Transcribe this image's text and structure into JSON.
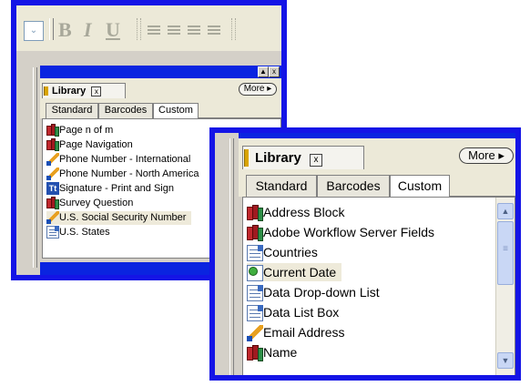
{
  "back": {
    "toolbar": {
      "dropdown_arrow": "⌄",
      "bold": "B",
      "italic": "I",
      "underline": "U"
    },
    "panel": {
      "title": "Library",
      "close": "x",
      "more": "More ▸",
      "minimize": "▲",
      "winclose": "x",
      "tabs": [
        "Standard",
        "Barcodes",
        "Custom"
      ],
      "items": [
        {
          "label": "Page n of m",
          "icon": "book-icon"
        },
        {
          "label": "Page Navigation",
          "icon": "book-icon"
        },
        {
          "label": "Phone Number - International",
          "icon": "pen-icon"
        },
        {
          "label": "Phone Number - North America",
          "icon": "pen-icon"
        },
        {
          "label": "Signature - Print and Sign",
          "icon": "signature-icon"
        },
        {
          "label": "Survey Question",
          "icon": "book-icon"
        },
        {
          "label": "U.S. Social Security Number",
          "icon": "pen-icon"
        },
        {
          "label": "U.S. States",
          "icon": "list-icon"
        }
      ]
    }
  },
  "front": {
    "panel": {
      "title": "Library",
      "close": "x",
      "more": "More ▸",
      "tabs": [
        "Standard",
        "Barcodes",
        "Custom"
      ],
      "items": [
        {
          "label": "Address Block",
          "icon": "book-icon"
        },
        {
          "label": "Adobe Workflow Server Fields",
          "icon": "book-icon"
        },
        {
          "label": "Countries",
          "icon": "list-icon"
        },
        {
          "label": "Current Date",
          "icon": "calculator-icon"
        },
        {
          "label": "Data Drop-down List",
          "icon": "list-icon"
        },
        {
          "label": "Data List Box",
          "icon": "list-icon"
        },
        {
          "label": "Email Address",
          "icon": "pen-icon"
        },
        {
          "label": "Name",
          "icon": "book-icon"
        }
      ],
      "scroll_up": "▲",
      "scroll_down": "▼",
      "scroll_grip": "≡"
    }
  },
  "colors": {
    "frame_border": "#1414e6",
    "titlebar": "#0a24e0",
    "panel_bg": "#d4d0c8",
    "toolbar_bg": "#ece9d8",
    "highlight": "#eeeada"
  }
}
